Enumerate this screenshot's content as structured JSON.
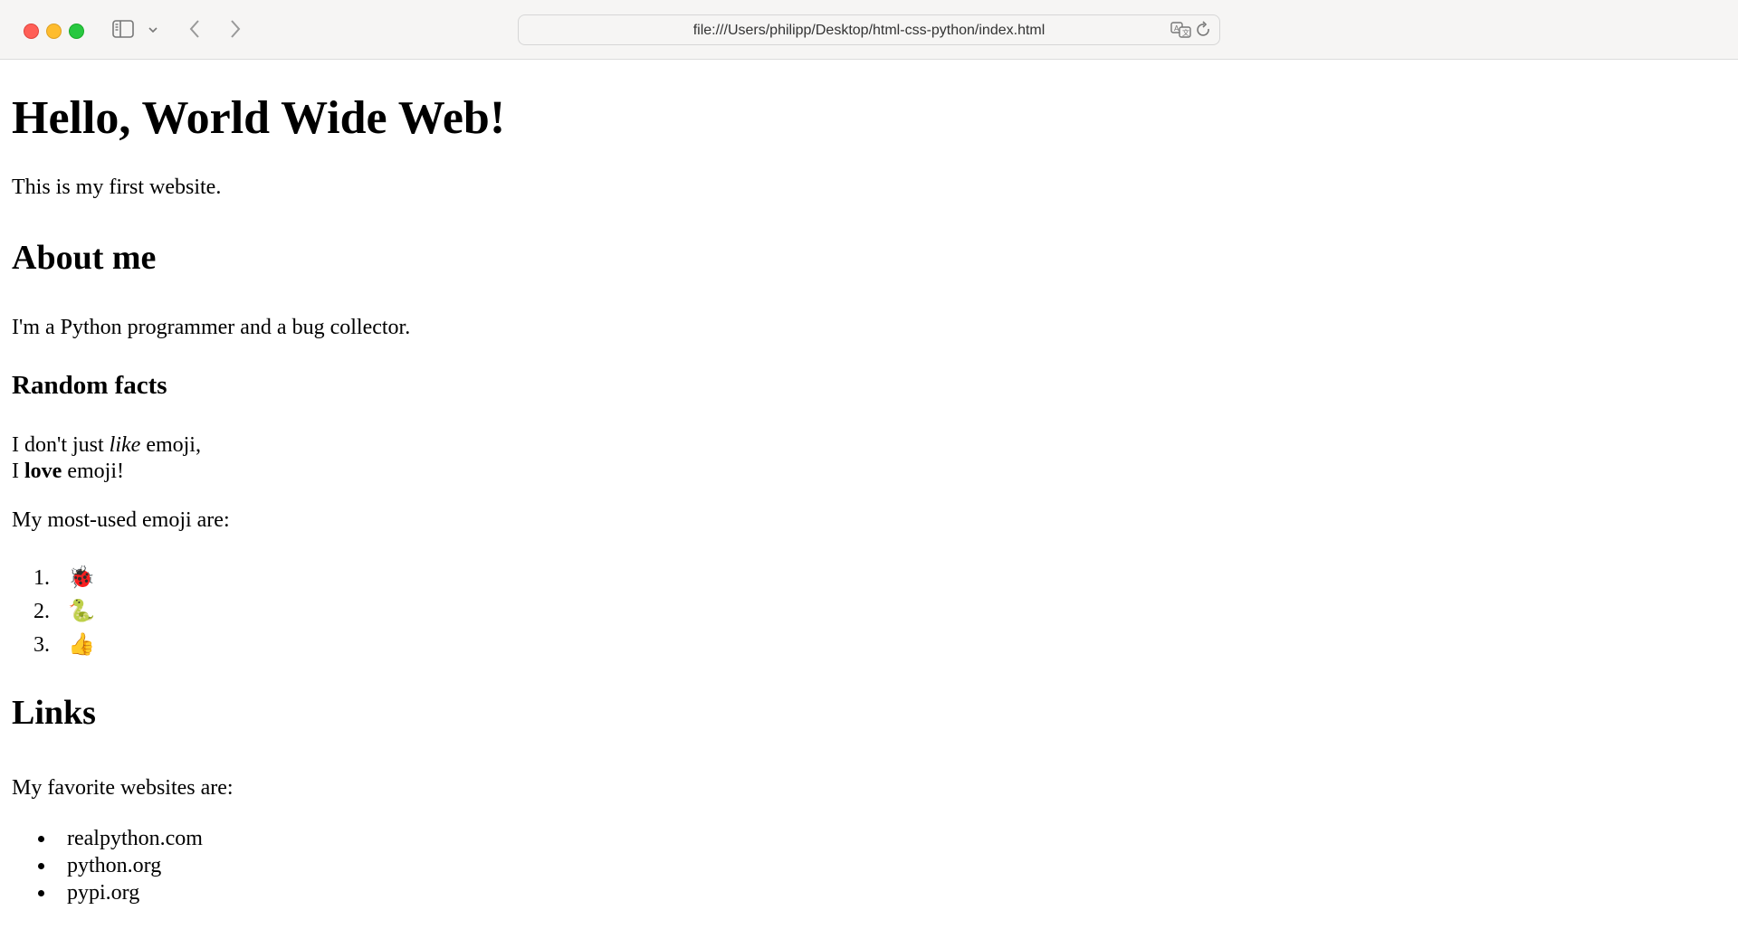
{
  "browser": {
    "url": "file:///Users/philipp/Desktop/html-css-python/index.html"
  },
  "page": {
    "heading": "Hello, World Wide Web!",
    "intro": "This is my first website.",
    "about": {
      "heading": "About me",
      "text": "I'm a Python programmer and a bug collector."
    },
    "facts": {
      "heading": "Random facts",
      "line1_pre": "I don't just ",
      "line1_em": "like",
      "line1_post": " emoji,",
      "line2_pre": "I ",
      "line2_strong": "love",
      "line2_post": " emoji!",
      "emoji_lead": "My most-used emoji are:",
      "emoji": [
        "🐞",
        "🐍",
        "👍"
      ]
    },
    "links": {
      "heading": "Links",
      "lead": "My favorite websites are:",
      "items": [
        "realpython.com",
        "python.org",
        "pypi.org"
      ]
    }
  },
  "icons": {
    "sidebar": "sidebar-icon",
    "chevron_down": "chevron-down-icon",
    "back": "chevron-left-icon",
    "forward": "chevron-right-icon",
    "translate": "translate-icon",
    "reload": "reload-icon"
  },
  "colors": {
    "close": "#ff5f57",
    "minimize": "#febc2e",
    "maximize": "#28c840"
  }
}
